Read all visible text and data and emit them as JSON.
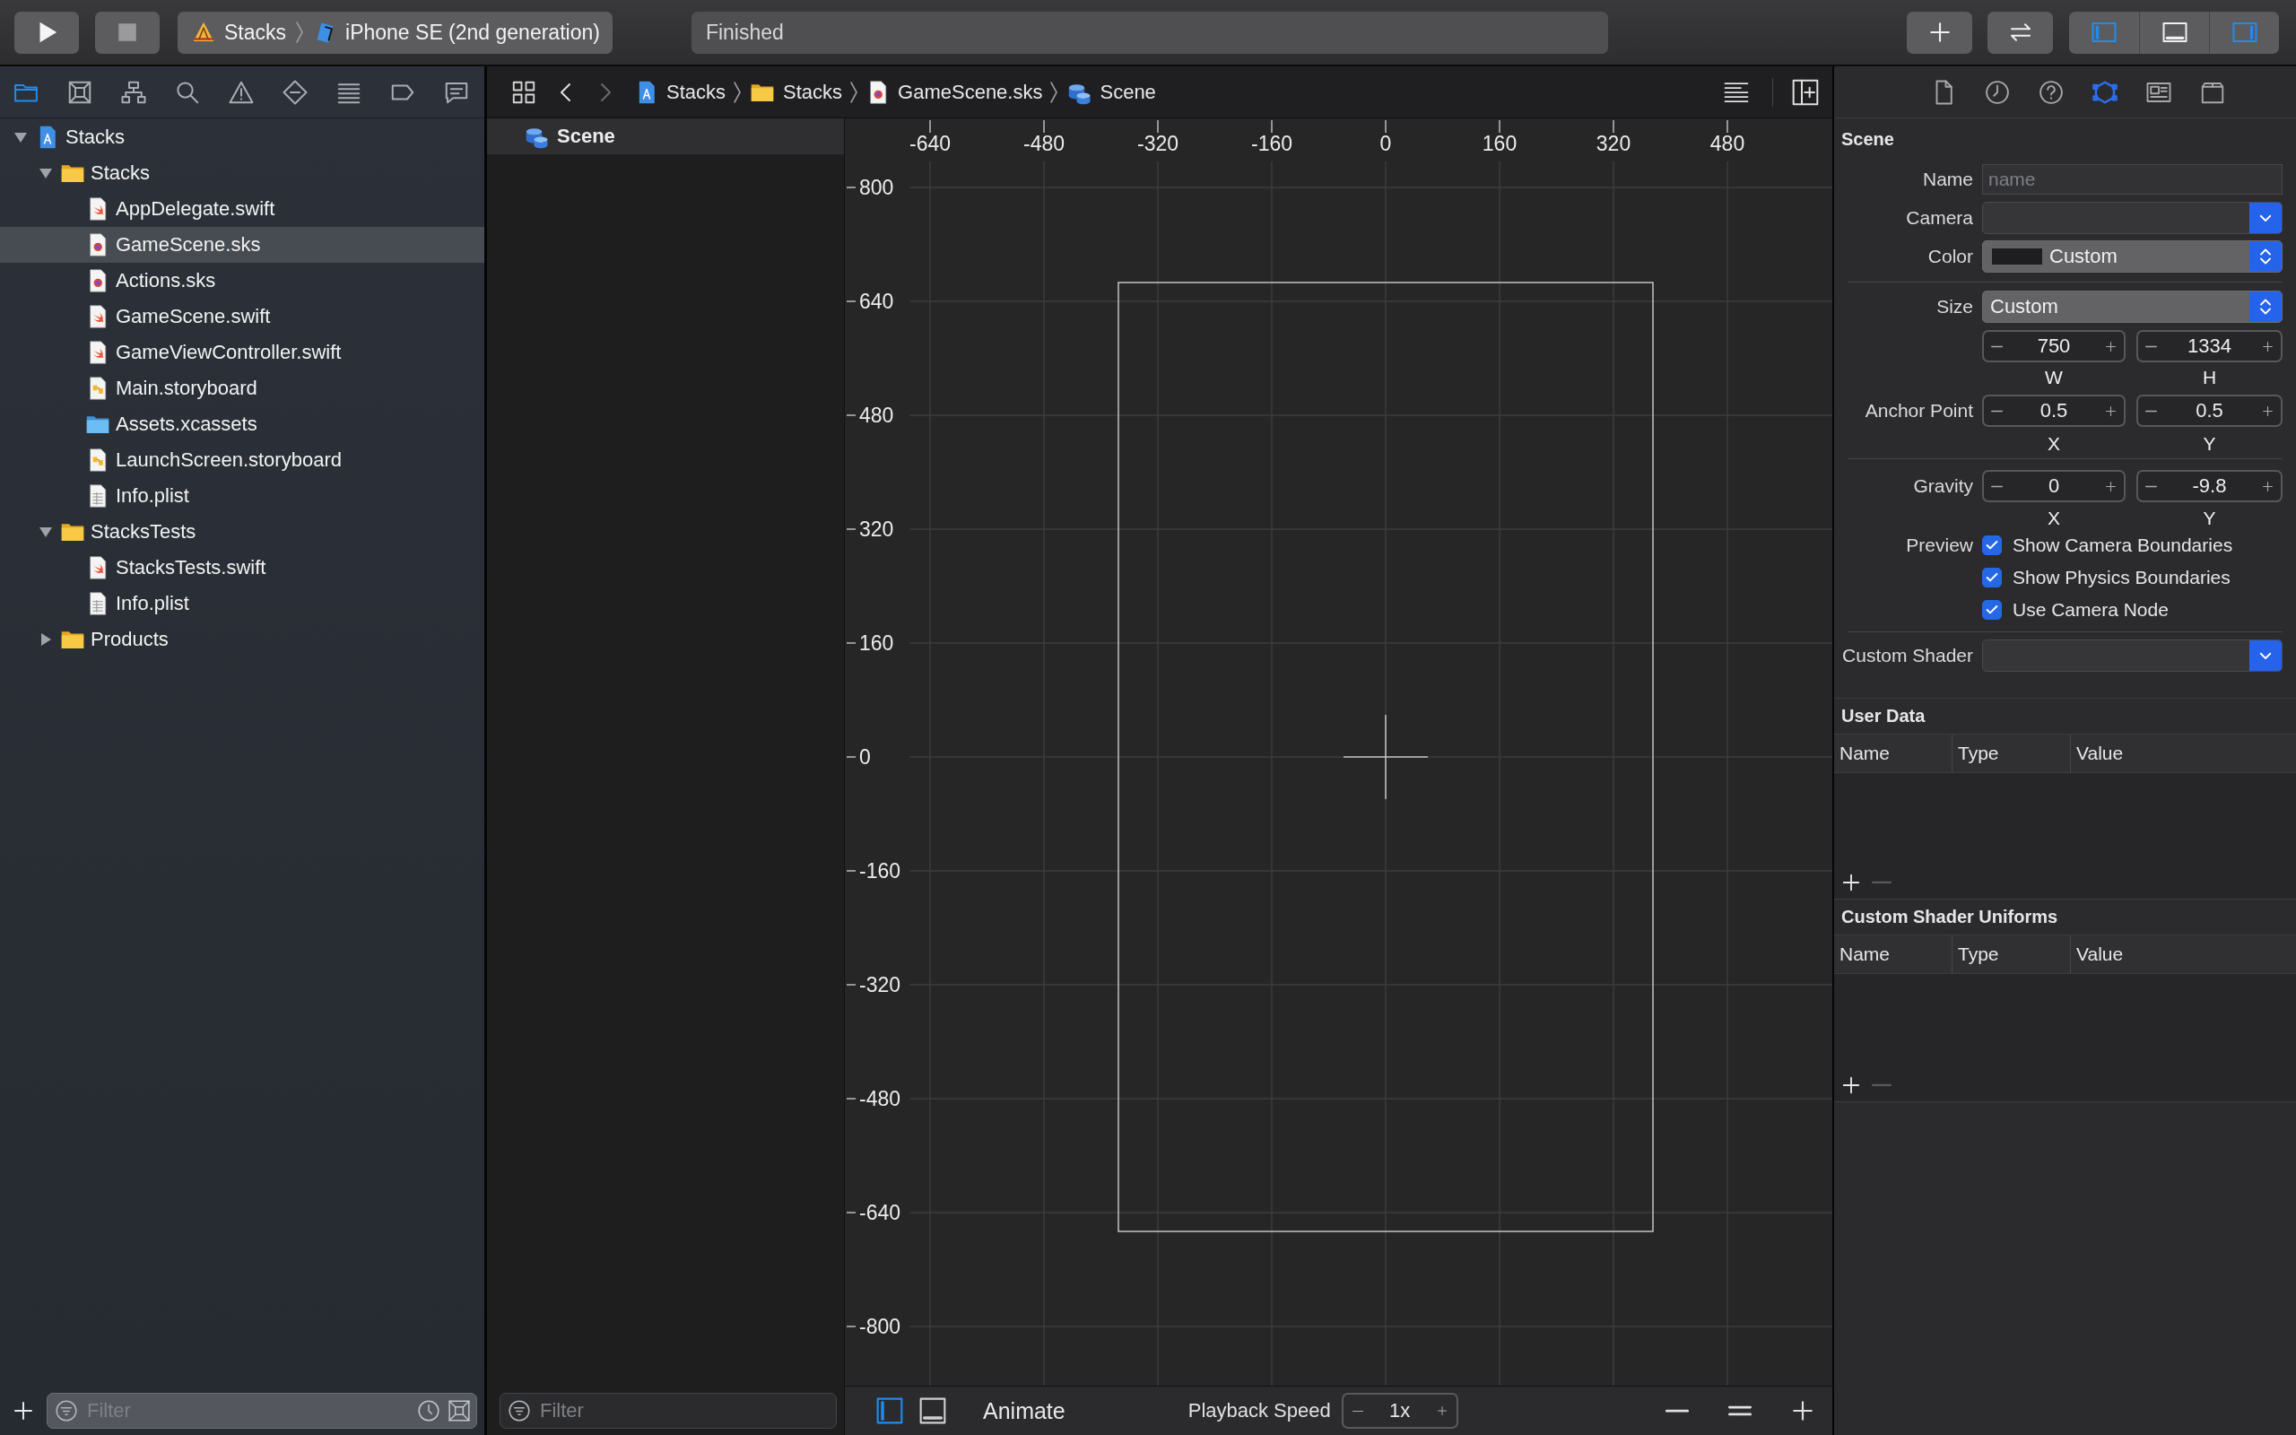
{
  "toolbar": {
    "scheme": {
      "project": "Stacks",
      "device": "iPhone SE (2nd generation)"
    },
    "status": "Finished",
    "panel_toggles": [
      {
        "on": true
      },
      {
        "on": false
      },
      {
        "on": true
      }
    ]
  },
  "navigator": {
    "tabs": [
      {
        "selected": true
      },
      {
        "selected": false
      },
      {
        "selected": false
      },
      {
        "selected": false
      },
      {
        "selected": false
      },
      {
        "selected": false
      },
      {
        "selected": false
      },
      {
        "selected": false
      },
      {
        "selected": false
      }
    ],
    "tree": [
      {
        "label": "Stacks",
        "kind": "project",
        "expanded": true,
        "selected": false,
        "children": [
          {
            "label": "Stacks",
            "kind": "folder",
            "expanded": true,
            "selected": false,
            "children": [
              {
                "label": "AppDelegate.swift",
                "kind": "swift",
                "selected": false
              },
              {
                "label": "GameScene.sks",
                "kind": "sks",
                "selected": true
              },
              {
                "label": "Actions.sks",
                "kind": "sks",
                "selected": false
              },
              {
                "label": "GameScene.swift",
                "kind": "swift",
                "selected": false
              },
              {
                "label": "GameViewController.swift",
                "kind": "swift",
                "selected": false
              },
              {
                "label": "Main.storyboard",
                "kind": "storyboard",
                "selected": false
              },
              {
                "label": "Assets.xcassets",
                "kind": "assets",
                "selected": false
              },
              {
                "label": "LaunchScreen.storyboard",
                "kind": "storyboard",
                "selected": false
              },
              {
                "label": "Info.plist",
                "kind": "plist",
                "selected": false
              }
            ]
          },
          {
            "label": "StacksTests",
            "kind": "folder",
            "expanded": true,
            "selected": false,
            "children": [
              {
                "label": "StacksTests.swift",
                "kind": "swift",
                "selected": false
              },
              {
                "label": "Info.plist",
                "kind": "plist",
                "selected": false
              }
            ]
          },
          {
            "label": "Products",
            "kind": "folder",
            "expanded": false,
            "selected": false
          }
        ]
      }
    ],
    "filter": {
      "placeholder": "Filter"
    }
  },
  "editor": {
    "jump_bar": [
      {
        "label": "Stacks",
        "kind": "project"
      },
      {
        "label": "Stacks",
        "kind": "folder"
      },
      {
        "label": "GameScene.sks",
        "kind": "sks"
      },
      {
        "label": "Scene",
        "kind": "scene"
      }
    ],
    "outline": {
      "items": [
        {
          "label": "Scene",
          "selected": true
        }
      ],
      "filter": {
        "placeholder": "Filter"
      }
    },
    "canvas": {
      "x_ruler": [
        "-640",
        "-480",
        "-320",
        "-160",
        "0",
        "160",
        "320",
        "480"
      ],
      "y_ruler": [
        "800",
        "640",
        "480",
        "320",
        "160",
        "0",
        "-160",
        "-320",
        "-480",
        "-640",
        "-800"
      ]
    },
    "bottom_bar": {
      "view_toggles": [
        {
          "selected": true
        },
        {
          "selected": false
        }
      ],
      "animate": "Animate",
      "playback_label": "Playback Speed",
      "playback_speed": "1x"
    }
  },
  "inspector": {
    "tabs": [
      {
        "selected": false
      },
      {
        "selected": false
      },
      {
        "selected": false
      },
      {
        "selected": true
      },
      {
        "selected": false
      },
      {
        "selected": false
      }
    ],
    "title": "Scene",
    "name": {
      "label": "Name",
      "placeholder": "name"
    },
    "camera": {
      "label": "Camera"
    },
    "color": {
      "label": "Color",
      "value": "Custom"
    },
    "size": {
      "label": "Size",
      "value": "Custom",
      "fields": [
        {
          "value": "750",
          "caption": "W"
        },
        {
          "value": "1334",
          "caption": "H"
        }
      ]
    },
    "anchor_point": {
      "label": "Anchor Point",
      "fields": [
        {
          "value": "0.5",
          "caption": "X"
        },
        {
          "value": "0.5",
          "caption": "Y"
        }
      ]
    },
    "gravity": {
      "label": "Gravity",
      "fields": [
        {
          "value": "0",
          "caption": "X"
        },
        {
          "value": "-9.8",
          "caption": "Y"
        }
      ]
    },
    "preview": {
      "label": "Preview",
      "options": [
        {
          "label": "Show Camera Boundaries",
          "checked": true
        },
        {
          "label": "Show Physics Boundaries",
          "checked": true
        },
        {
          "label": "Use Camera Node",
          "checked": true
        }
      ]
    },
    "custom_shader": {
      "label": "Custom Shader"
    },
    "sections": [
      {
        "title": "User Data",
        "columns": [
          "Name",
          "Type",
          "Value"
        ]
      },
      {
        "title": "Custom Shader Uniforms",
        "columns": [
          "Name",
          "Type",
          "Value"
        ]
      }
    ]
  }
}
